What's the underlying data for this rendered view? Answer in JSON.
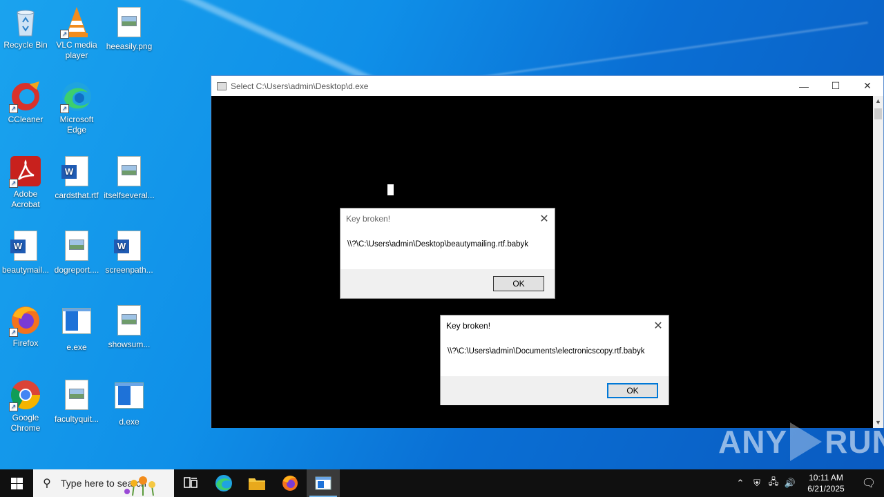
{
  "desktop": {
    "icons": [
      {
        "label": "Recycle Bin",
        "icon": "recycle-bin-icon"
      },
      {
        "label": "VLC media player",
        "icon": "vlc-icon"
      },
      {
        "label": "heeasily.png",
        "icon": "image-file-icon"
      },
      {
        "label": "CCleaner",
        "icon": "ccleaner-icon"
      },
      {
        "label": "Microsoft Edge",
        "icon": "edge-icon"
      },
      {
        "label": "Adobe Acrobat",
        "icon": "acrobat-icon"
      },
      {
        "label": "cardsthat.rtf",
        "icon": "word-doc-icon"
      },
      {
        "label": "itselfseveral...",
        "icon": "image-file-icon"
      },
      {
        "label": "beautymail...",
        "icon": "word-doc-icon"
      },
      {
        "label": "dogreport....",
        "icon": "image-file-icon"
      },
      {
        "label": "screenpath...",
        "icon": "word-doc-icon"
      },
      {
        "label": "Firefox",
        "icon": "firefox-icon"
      },
      {
        "label": "e.exe",
        "icon": "exe-icon"
      },
      {
        "label": "showsum...",
        "icon": "image-file-icon"
      },
      {
        "label": "Google Chrome",
        "icon": "chrome-icon"
      },
      {
        "label": "facultyquit...",
        "icon": "image-file-icon"
      },
      {
        "label": "d.exe",
        "icon": "exe-icon"
      }
    ]
  },
  "console_window": {
    "title": "Select C:\\Users\\admin\\Desktop\\d.exe",
    "minimize": "—",
    "maximize": "☐",
    "close": "✕"
  },
  "dialogs": [
    {
      "title": "Key broken!",
      "message": "\\\\?\\C:\\Users\\admin\\Desktop\\beautymailing.rtf.babyk",
      "ok": "OK"
    },
    {
      "title": "Key broken!",
      "message": "\\\\?\\C:\\Users\\admin\\Documents\\electronicscopy.rtf.babyk",
      "ok": "OK"
    }
  ],
  "watermark": {
    "left": "ANY",
    "right": "RUN"
  },
  "taskbar": {
    "search_placeholder": "Type here to search",
    "time": "10:11 AM",
    "date": "6/21/2025"
  }
}
